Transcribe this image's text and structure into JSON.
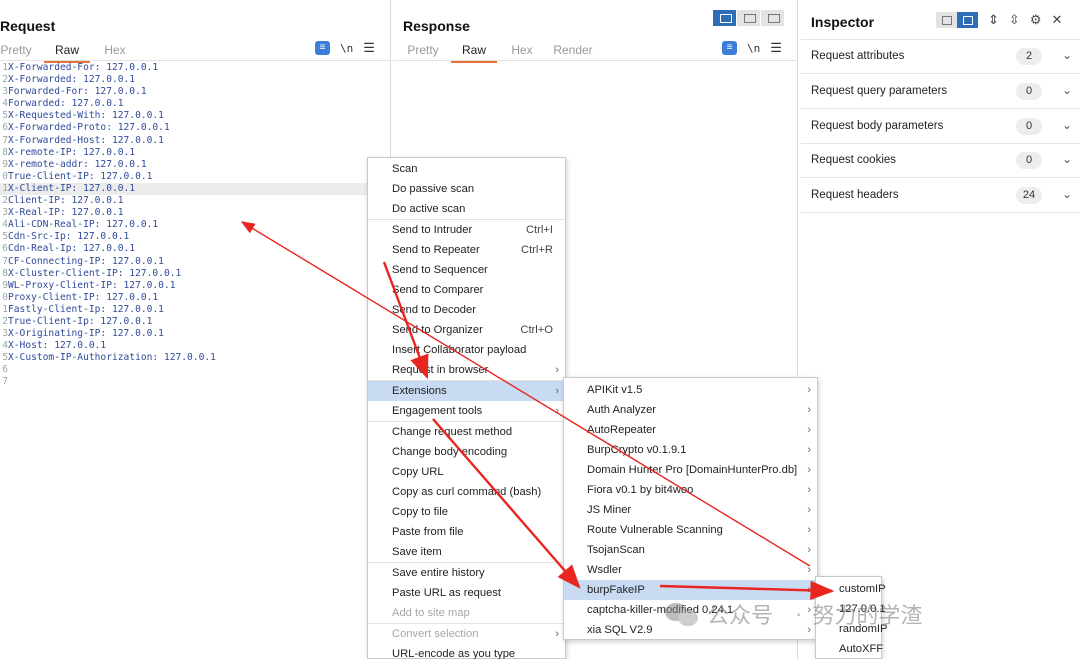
{
  "request": {
    "title": "Request",
    "tabs": [
      "Pretty",
      "Raw",
      "Hex"
    ],
    "active_tab": "Raw",
    "newline_label": "\\n",
    "lines": [
      {
        "n": "1",
        "t": "X-Forwarded-For: 127.0.0.1"
      },
      {
        "n": "2",
        "t": "X-Forwarded: 127.0.0.1"
      },
      {
        "n": "3",
        "t": "Forwarded-For: 127.0.0.1"
      },
      {
        "n": "4",
        "t": "Forwarded: 127.0.0.1"
      },
      {
        "n": "5",
        "t": "X-Requested-With: 127.0.0.1"
      },
      {
        "n": "6",
        "t": "X-Forwarded-Proto: 127.0.0.1"
      },
      {
        "n": "7",
        "t": "X-Forwarded-Host: 127.0.0.1"
      },
      {
        "n": "8",
        "t": "X-remote-IP: 127.0.0.1"
      },
      {
        "n": "9",
        "t": "X-remote-addr: 127.0.0.1"
      },
      {
        "n": "0",
        "t": "True-Client-IP: 127.0.0.1"
      },
      {
        "n": "1",
        "t": "X-Client-IP: 127.0.0.1",
        "hl": true
      },
      {
        "n": "2",
        "t": "Client-IP: 127.0.0.1"
      },
      {
        "n": "3",
        "t": "X-Real-IP: 127.0.0.1"
      },
      {
        "n": "4",
        "t": "Ali-CDN-Real-IP: 127.0.0.1"
      },
      {
        "n": "5",
        "t": "Cdn-Src-Ip: 127.0.0.1"
      },
      {
        "n": "6",
        "t": "Cdn-Real-Ip: 127.0.0.1"
      },
      {
        "n": "7",
        "t": "CF-Connecting-IP: 127.0.0.1"
      },
      {
        "n": "8",
        "t": "X-Cluster-Client-IP: 127.0.0.1"
      },
      {
        "n": "9",
        "t": "WL-Proxy-Client-IP: 127.0.0.1"
      },
      {
        "n": "0",
        "t": "Proxy-Client-IP: 127.0.0.1"
      },
      {
        "n": "1",
        "t": "Fastly-Client-Ip: 127.0.0.1"
      },
      {
        "n": "2",
        "t": "True-Client-Ip: 127.0.0.1"
      },
      {
        "n": "3",
        "t": "X-Originating-IP: 127.0.0.1"
      },
      {
        "n": "4",
        "t": "X-Host: 127.0.0.1"
      },
      {
        "n": "5",
        "t": "X-Custom-IP-Authorization: 127.0.0.1"
      },
      {
        "n": "6",
        "t": ""
      },
      {
        "n": "7",
        "t": ""
      }
    ]
  },
  "response": {
    "title": "Response",
    "tabs": [
      "Pretty",
      "Raw",
      "Hex",
      "Render"
    ],
    "active_tab": "Raw",
    "newline_label": "\\n"
  },
  "inspector": {
    "title": "Inspector",
    "rows": [
      {
        "label": "Request attributes",
        "count": "2"
      },
      {
        "label": "Request query parameters",
        "count": "0"
      },
      {
        "label": "Request body parameters",
        "count": "0"
      },
      {
        "label": "Request cookies",
        "count": "0"
      },
      {
        "label": "Request headers",
        "count": "24"
      }
    ]
  },
  "context_menu": {
    "items": [
      {
        "label": "Scan"
      },
      {
        "label": "Do passive scan"
      },
      {
        "label": "Do active scan",
        "sep_after": true
      },
      {
        "label": "Send to Intruder",
        "shortcut": "Ctrl+I"
      },
      {
        "label": "Send to Repeater",
        "shortcut": "Ctrl+R"
      },
      {
        "label": "Send to Sequencer"
      },
      {
        "label": "Send to Comparer"
      },
      {
        "label": "Send to Decoder"
      },
      {
        "label": "Send to Organizer",
        "shortcut": "Ctrl+O"
      },
      {
        "label": "Insert Collaborator payload"
      },
      {
        "label": "Request in browser",
        "submenu": true,
        "sep_after": true
      },
      {
        "label": "Extensions",
        "submenu": true,
        "selected": true
      },
      {
        "label": "Engagement tools",
        "submenu": true,
        "sep_after": true
      },
      {
        "label": "Change request method"
      },
      {
        "label": "Change body encoding"
      },
      {
        "label": "Copy URL"
      },
      {
        "label": "Copy as curl command (bash)"
      },
      {
        "label": "Copy to file"
      },
      {
        "label": "Paste from file"
      },
      {
        "label": "Save item",
        "sep_after": true
      },
      {
        "label": "Save entire history"
      },
      {
        "label": "Paste URL as request"
      },
      {
        "label": "Add to site map",
        "disabled": true,
        "sep_after": true
      },
      {
        "label": "Convert selection",
        "submenu": true,
        "disabled": true
      },
      {
        "label": "URL-encode as you type"
      }
    ]
  },
  "extensions_menu": {
    "items": [
      {
        "label": "APIKit v1.5"
      },
      {
        "label": "Auth Analyzer"
      },
      {
        "label": "AutoRepeater"
      },
      {
        "label": "BurpCrypto v0.1.9.1"
      },
      {
        "label": "Domain Hunter Pro [DomainHunterPro.db]"
      },
      {
        "label": "Fiora v0.1 by bit4woo"
      },
      {
        "label": "JS Miner"
      },
      {
        "label": "Route Vulnerable Scanning"
      },
      {
        "label": "TsojanScan"
      },
      {
        "label": "Wsdler"
      },
      {
        "label": "burpFakeIP",
        "selected": true
      },
      {
        "label": "captcha-killer-modified 0.24.1"
      },
      {
        "label": "xia SQL V2.9"
      }
    ]
  },
  "fakeip_menu": {
    "items": [
      {
        "label": "customIP"
      },
      {
        "label": "127.0.0.1"
      },
      {
        "label": "randomIP"
      },
      {
        "label": "AutoXFF"
      }
    ]
  },
  "watermark": {
    "account_prefix": "公众号",
    "separator": "·",
    "account_name": "努力的学渣"
  },
  "colors": {
    "accent_tab": "#e8703a",
    "menu_selected": "#c8dbf3",
    "toggle_on": "#2f6db8",
    "annotation_arrow": "#e8251f",
    "code_text": "#2f4a9a"
  }
}
